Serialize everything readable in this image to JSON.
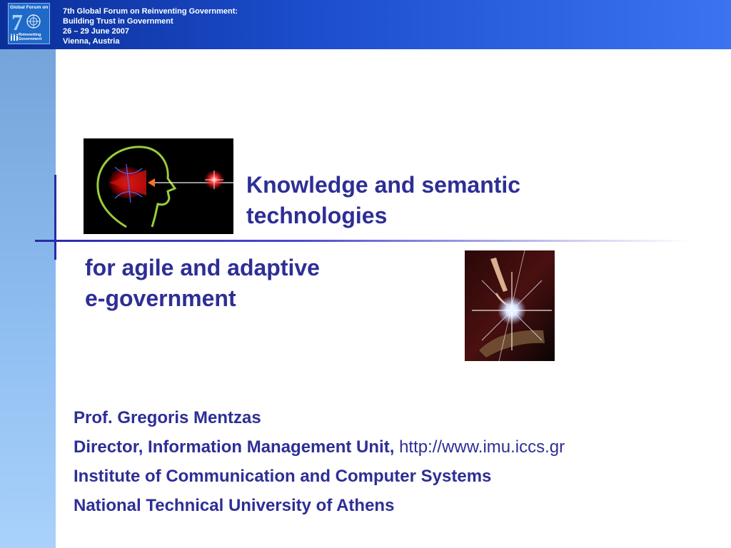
{
  "header": {
    "lines": [
      "7th Global Forum on Reinventing Government:",
      "Building Trust in Government",
      "26 – 29 June 2007",
      "Vienna, Austria"
    ],
    "logo": {
      "top_text": "Global Forum  on",
      "numeral": "7",
      "sub_line1": "Reinventing",
      "sub_line2": "Government"
    }
  },
  "slide": {
    "title_line1": "Knowledge and semantic",
    "title_line2": "technologies",
    "subtitle_line1": "for agile and adaptive",
    "subtitle_line2": "e-government"
  },
  "author": {
    "name": "Prof. Gregoris Mentzas",
    "role": "Director, Information Management Unit,",
    "url": "http://www.imu.iccs.gr",
    "institute": "Institute of Communication and Computer Systems",
    "university": "National Technical University of Athens"
  },
  "images": {
    "image1_icon": "head-laser-illustration",
    "image2_icon": "hand-light-burst-photo"
  },
  "colors": {
    "accent_text": "#2e2e96",
    "header_start": "#0b2f9a",
    "header_end": "#3b74f0",
    "sidebar": "#8cbcef"
  }
}
